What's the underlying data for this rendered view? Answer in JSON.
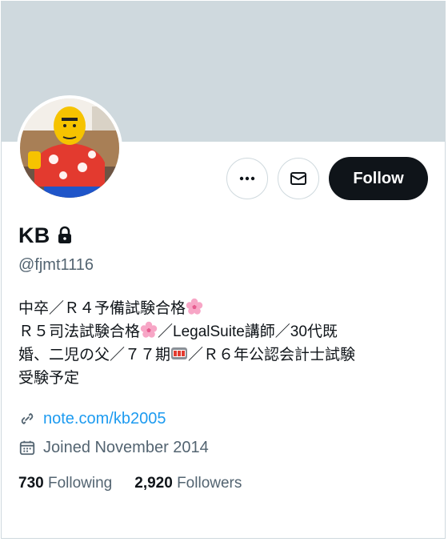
{
  "profile": {
    "name": "KB",
    "handle": "@fjmt1116",
    "bio": {
      "line1": "中卒／Ｒ４予備試験合格",
      "line2a": "Ｒ５司法試験合格",
      "line2b": "／LegalSuite講師／30代既",
      "line3a": "婚、二児の父／７７期",
      "line3b": "／Ｒ６年公認会計士試験",
      "line4": "受験予定"
    },
    "link": "note.com/kb2005",
    "joined": "Joined November 2014",
    "following_count": "730",
    "following_label": "Following",
    "followers_count": "2,920",
    "followers_label": "Followers"
  },
  "actions": {
    "follow_label": "Follow"
  },
  "icons": {
    "lock": "lock-icon",
    "more": "more-icon",
    "message": "message-icon",
    "link": "link-icon",
    "calendar": "calendar-icon",
    "flower": "cherry-blossom-emoji",
    "slot": "slot-machine-emoji"
  },
  "colors": {
    "banner": "#cfd9de",
    "link": "#1d9bf0",
    "muted": "#536471",
    "text": "#0f1419",
    "follow_bg": "#0f1419"
  }
}
